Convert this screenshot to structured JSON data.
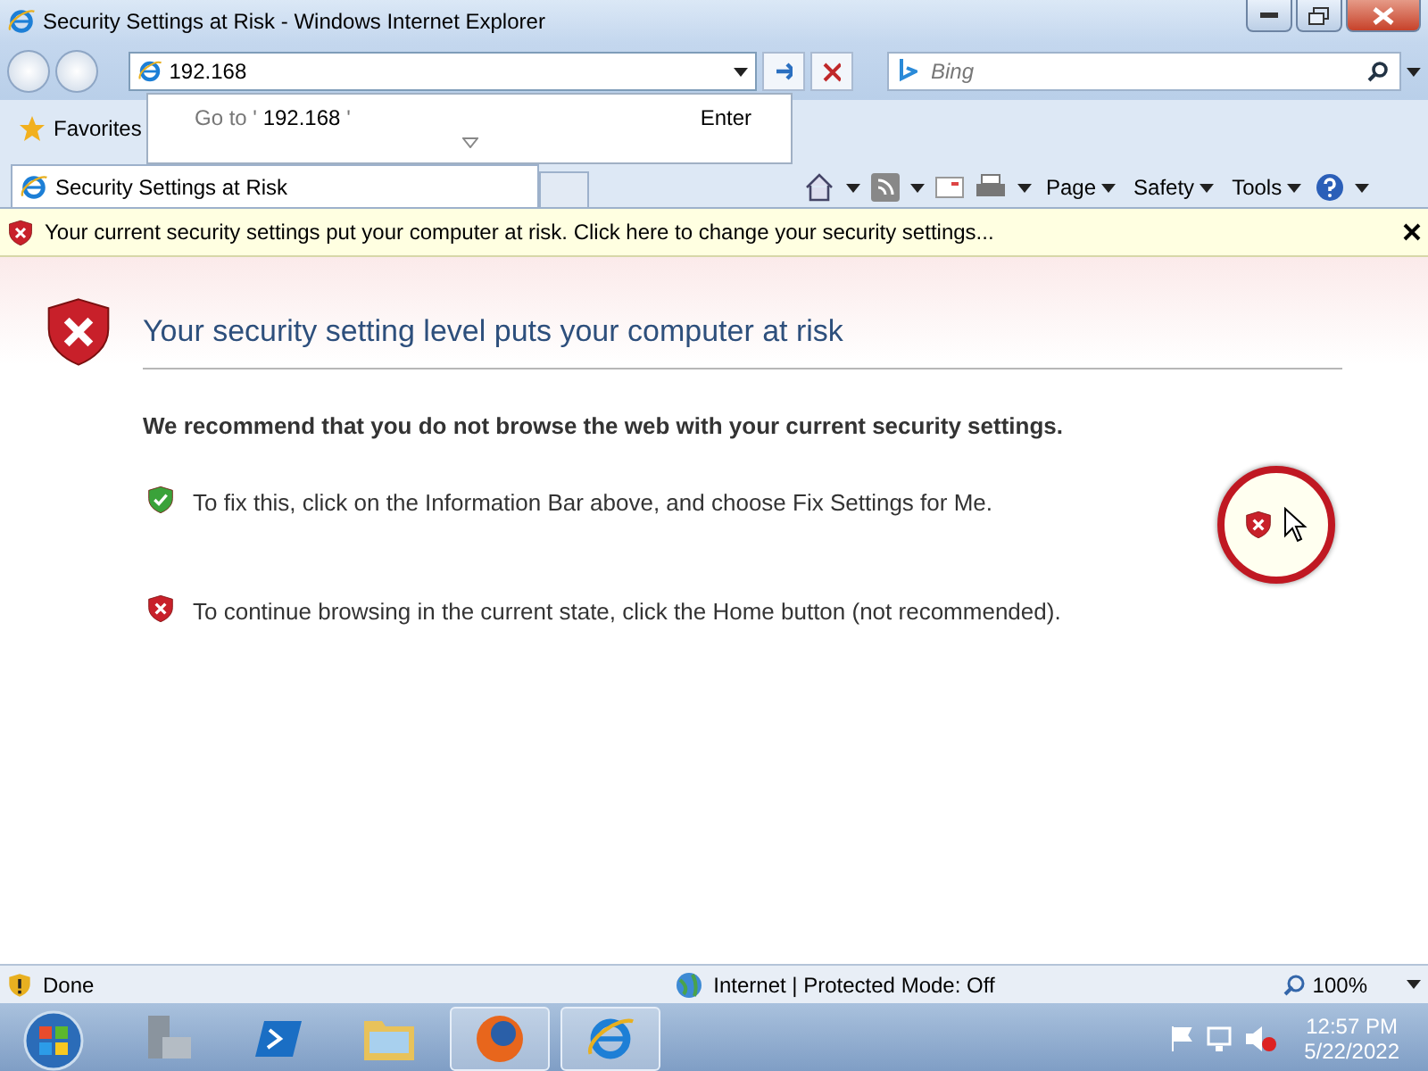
{
  "window": {
    "title": "Security Settings at Risk - Windows Internet Explorer"
  },
  "address": {
    "value": "192.168",
    "suggestion": {
      "prefix": "Go to '",
      "value": "192.168",
      "suffix": "'",
      "shortcut": "Enter"
    }
  },
  "search": {
    "placeholder": "Bing"
  },
  "favorites": {
    "label": "Favorites"
  },
  "tabs": [
    {
      "title": "Security Settings at Risk",
      "selected": true
    }
  ],
  "command_bar": {
    "menus": [
      "Page",
      "Safety",
      "Tools"
    ]
  },
  "info_bar": {
    "text": "Your current security settings put your computer at risk. Click here to change your security settings..."
  },
  "content": {
    "heading": "Your security setting level puts your computer at risk",
    "recommendation": "We recommend that you do not browse the web with your current security settings.",
    "items": [
      {
        "kind": "ok",
        "text": "To fix this, click on the Information Bar above, and choose Fix Settings for Me."
      },
      {
        "kind": "risk",
        "text": "To continue browsing in the current state, click the Home button (not recommended)."
      }
    ]
  },
  "status_bar": {
    "status": "Done",
    "zone": "Internet | Protected Mode: Off",
    "zoom": "100%"
  },
  "taskbar": {
    "apps": [
      {
        "kind": "server",
        "selected": false
      },
      {
        "kind": "powershell",
        "selected": false
      },
      {
        "kind": "folder",
        "selected": false
      },
      {
        "kind": "firefox",
        "selected": true
      },
      {
        "kind": "ie",
        "selected": true
      }
    ],
    "time": "12:57 PM",
    "date": "5/22/2022"
  }
}
